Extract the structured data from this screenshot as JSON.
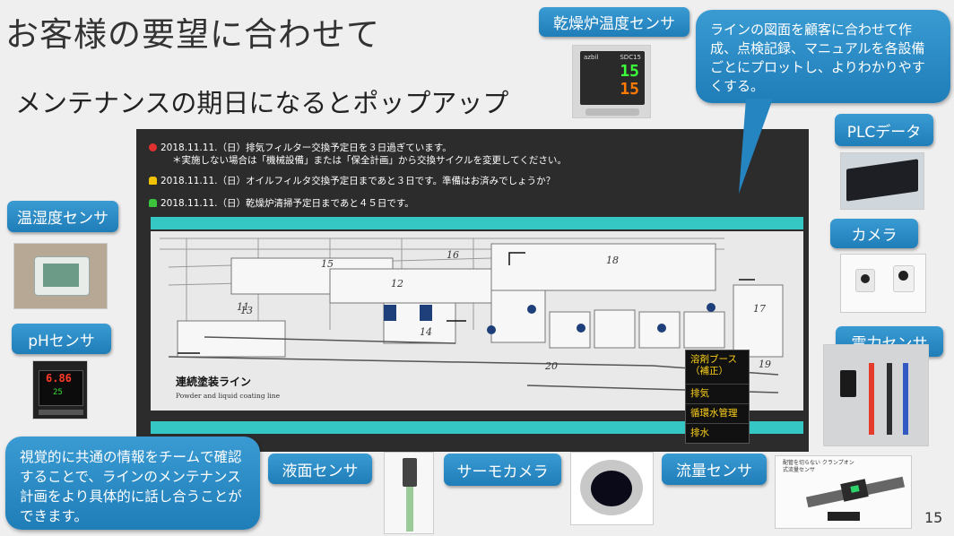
{
  "title": "お客様の要望に合わせて",
  "subtitle": "メンテナンスの期日になるとポップアップ",
  "alerts": [
    {
      "icon": "red-circle-icon",
      "color": "#e03030",
      "line1": "2018.11.11.（日）排気フィルター交換予定日を３日過ぎています。",
      "line2": "＊実施しない場合は「機械設備」または「保全計画」から交換サイクルを変更してください。"
    },
    {
      "icon": "yellow-bell-icon",
      "color": "#f2c200",
      "line1": "2018.11.11.（日）オイルフィルタ交換予定日まであと３日です。準備はお済みでしょうか？"
    },
    {
      "icon": "green-bell-icon",
      "color": "#3cc43c",
      "line1": "2018.11.11.（日）乾燥炉清掃予定日まであと４５日です。"
    }
  ],
  "line_name": "連続塗装ライン",
  "line_name_en": "Powder and liquid coating line",
  "area_numbers": [
    "11",
    "12",
    "13",
    "14",
    "15",
    "16",
    "17",
    "18",
    "19",
    "20"
  ],
  "legend_items": [
    "溶剤ブース（補正）",
    "排気",
    "循環水管理",
    "排水"
  ],
  "labels": {
    "drying_temp": "乾燥炉温度センサ",
    "plc": "PLCデータ",
    "camera": "カメラ",
    "power": "電力センサ",
    "humidity": "温湿度センサ",
    "ph": "pHセンサ",
    "level": "液面センサ",
    "thermo": "サーモカメラ",
    "flow": "流量センサ"
  },
  "bubble_top": "ラインの図面を顧客に合わせて作成、点検記録、マニュアルを各設備ごとにプロットし、よりわかりやすくする。",
  "bubble_bottom": "視覚的に共通の情報をチームで確認することで、ラインのメンテナンス計画をより具体的に話し合うことができます。",
  "controller_display": {
    "brand": "azbil",
    "model": "SDC15",
    "pv": "15",
    "sv": "15"
  },
  "ph_display": {
    "value": "6.86",
    "sub": "25"
  },
  "flow_sensor_caption": "配管を切らない クランプオン式流量センサ",
  "page_number": "15",
  "colors": {
    "accent": "#2b8ac6",
    "teal_bar": "#35c7c4",
    "legend_text": "#ffd319"
  }
}
